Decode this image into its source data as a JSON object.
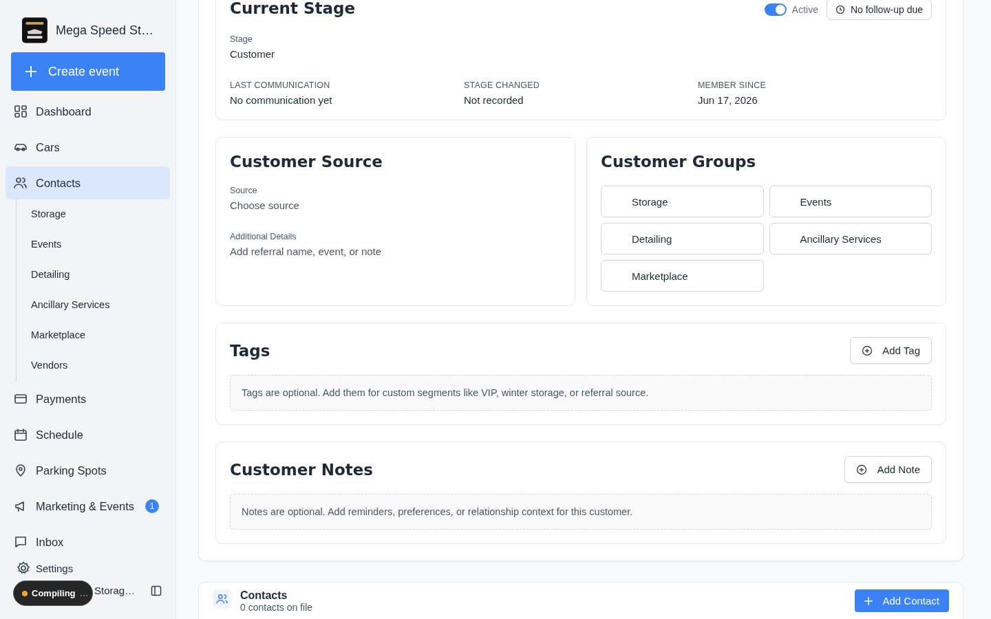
{
  "sidebar": {
    "brand": "Mega Speed St…",
    "create_button": "Create event",
    "nav": [
      {
        "label": "Dashboard",
        "selected": false
      },
      {
        "label": "Cars",
        "selected": false
      },
      {
        "label": "Contacts",
        "selected": true,
        "children": [
          {
            "label": "Storage"
          },
          {
            "label": "Events"
          },
          {
            "label": "Detailing"
          },
          {
            "label": "Ancillary Services"
          },
          {
            "label": "Marketplace"
          },
          {
            "label": "Vendors"
          }
        ]
      },
      {
        "label": "Payments",
        "selected": false
      },
      {
        "label": "Schedule",
        "selected": false
      },
      {
        "label": "Parking Spots",
        "selected": false
      },
      {
        "label": "Marketing & Events",
        "selected": false,
        "badge": "1"
      },
      {
        "label": "Inbox",
        "selected": false
      }
    ],
    "settings": "Settings",
    "user": "Storag…"
  },
  "toast": {
    "label": "Compiling",
    "ellipsis": "…"
  },
  "current_stage": {
    "title": "Current Stage",
    "toggle": {
      "label": "Active",
      "on": true
    },
    "followup_button": "No follow-up due",
    "stage": {
      "label": "Stage",
      "value": "Customer"
    },
    "facts": [
      {
        "label": "LAST COMMUNICATION",
        "value": "No communication yet"
      },
      {
        "label": "STAGE CHANGED",
        "value": "Not recorded"
      },
      {
        "label": "MEMBER SINCE",
        "value": "Jun 17, 2026"
      }
    ]
  },
  "customer_source": {
    "title": "Customer Source",
    "fields": [
      {
        "label": "Source",
        "placeholder": "Choose source"
      },
      {
        "label": "Additional Details",
        "placeholder": "Add referral name, event, or note"
      }
    ]
  },
  "customer_groups": {
    "title": "Customer Groups",
    "groups": [
      "Storage",
      "Events",
      "Detailing",
      "Ancillary Services",
      "Marketplace"
    ]
  },
  "tags": {
    "title": "Tags",
    "button": "Add Tag",
    "empty": "Tags are optional. Add them for custom segments like VIP, winter storage, or referral source."
  },
  "notes": {
    "title": "Customer Notes",
    "button": "Add Note",
    "empty": "Notes are optional. Add reminders, preferences, or relationship context for this customer."
  },
  "contacts": {
    "title": "Contacts",
    "subtitle": "0 contacts on file",
    "button": "Add Contact"
  }
}
